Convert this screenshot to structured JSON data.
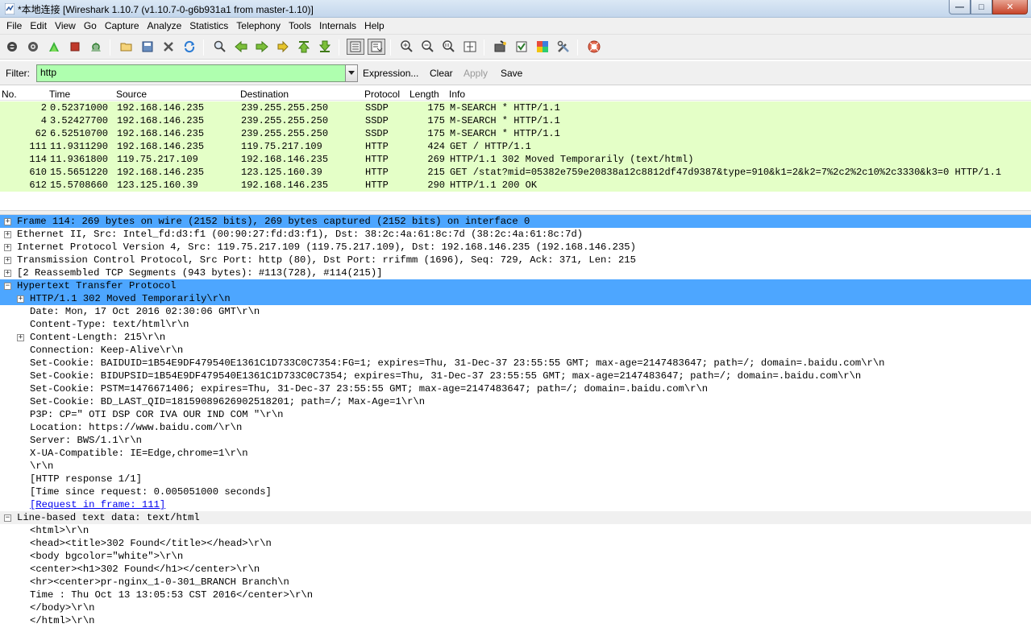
{
  "window": {
    "title": "*本地连接   [Wireshark 1.10.7  (v1.10.7-0-g6b931a1 from master-1.10)]",
    "buttons": {
      "minimize": "—",
      "maximize": "□",
      "close": "✕"
    }
  },
  "menu": [
    "File",
    "Edit",
    "View",
    "Go",
    "Capture",
    "Analyze",
    "Statistics",
    "Telephony",
    "Tools",
    "Internals",
    "Help"
  ],
  "toolbar_icons": [
    "interface-list-icon",
    "capture-options-icon",
    "start-capture-icon",
    "stop-capture-icon",
    "restart-capture-icon",
    "open-file-icon",
    "save-file-icon",
    "close-file-icon",
    "reload-icon",
    "find-packet-icon",
    "go-back-icon",
    "go-forward-icon",
    "go-to-packet-icon",
    "go-first-icon",
    "go-last-icon",
    "colorize-icon",
    "auto-scroll-icon",
    "zoom-in-icon",
    "zoom-out-icon",
    "normal-size-icon",
    "resize-columns-icon",
    "capture-filters-icon",
    "display-filters-icon",
    "coloring-rules-icon",
    "preferences-icon",
    "help-icon"
  ],
  "filter": {
    "label": "Filter:",
    "value": "http",
    "expression": "Expression...",
    "clear": "Clear",
    "apply": "Apply",
    "save": "Save",
    "valid_color": "#afffaf"
  },
  "packet_list": {
    "columns": [
      "No.",
      "Time",
      "Source",
      "Destination",
      "Protocol",
      "Length",
      "Info"
    ],
    "row_color": "#e4ffc7",
    "rows": [
      {
        "no": "2",
        "time": "0.52371000",
        "src": "192.168.146.235",
        "dst": "239.255.255.250",
        "proto": "SSDP",
        "len": "175",
        "info": "M-SEARCH * HTTP/1.1"
      },
      {
        "no": "4",
        "time": "3.52427700",
        "src": "192.168.146.235",
        "dst": "239.255.255.250",
        "proto": "SSDP",
        "len": "175",
        "info": "M-SEARCH * HTTP/1.1"
      },
      {
        "no": "62",
        "time": "6.52510700",
        "src": "192.168.146.235",
        "dst": "239.255.255.250",
        "proto": "SSDP",
        "len": "175",
        "info": "M-SEARCH * HTTP/1.1"
      },
      {
        "no": "111",
        "time": "11.9311290",
        "src": "192.168.146.235",
        "dst": "119.75.217.109",
        "proto": "HTTP",
        "len": "424",
        "info": "GET / HTTP/1.1"
      },
      {
        "no": "114",
        "time": "11.9361800",
        "src": "119.75.217.109",
        "dst": "192.168.146.235",
        "proto": "HTTP",
        "len": "269",
        "info": "HTTP/1.1 302 Moved Temporarily  (text/html)"
      },
      {
        "no": "610",
        "time": "15.5651220",
        "src": "192.168.146.235",
        "dst": "123.125.160.39",
        "proto": "HTTP",
        "len": "215",
        "info": "GET /stat?mid=05382e759e20838a12c8812df47d9387&type=910&k1=2&k2=7%2c2%2c10%2c3330&k3=0 HTTP/1.1"
      },
      {
        "no": "612",
        "time": "15.5708660",
        "src": "123.125.160.39",
        "dst": "192.168.146.235",
        "proto": "HTTP",
        "len": "290",
        "info": "HTTP/1.1 200 OK"
      }
    ]
  },
  "details": {
    "selected_color": "#4da6ff",
    "rows": [
      {
        "text": "Frame 114: 269 bytes on wire (2152 bits), 269 bytes captured (2152 bits) on interface 0",
        "expander": "+",
        "state": "selected"
      },
      {
        "text": "Ethernet II, Src: Intel_fd:d3:f1 (00:90:27:fd:d3:f1), Dst: 38:2c:4a:61:8c:7d (38:2c:4a:61:8c:7d)",
        "expander": "+",
        "state": ""
      },
      {
        "text": "Internet Protocol Version 4, Src: 119.75.217.109 (119.75.217.109), Dst: 192.168.146.235 (192.168.146.235)",
        "expander": "+",
        "state": ""
      },
      {
        "text": "Transmission Control Protocol, Src Port: http (80), Dst Port: rrifmm (1696), Seq: 729, Ack: 371, Len: 215",
        "expander": "+",
        "state": ""
      },
      {
        "text": "[2 Reassembled TCP Segments (943 bytes): #113(728), #114(215)]",
        "expander": "+",
        "state": ""
      },
      {
        "text": "Hypertext Transfer Protocol",
        "expander": "−",
        "state": "selected"
      },
      {
        "text": "HTTP/1.1 302 Moved Temporarily\\r\\n",
        "expander": "+",
        "state": "selected"
      },
      {
        "text": "Date: Mon, 17 Oct 2016 02:30:06 GMT\\r\\n",
        "expander": "",
        "state": ""
      },
      {
        "text": "Content-Type: text/html\\r\\n",
        "expander": "",
        "state": ""
      },
      {
        "text": "Content-Length: 215\\r\\n",
        "expander": "+",
        "state": ""
      },
      {
        "text": "Connection: Keep-Alive\\r\\n",
        "expander": "",
        "state": ""
      },
      {
        "text": "Set-Cookie: BAIDUID=1B54E9DF479540E1361C1D733C0C7354:FG=1; expires=Thu, 31-Dec-37 23:55:55 GMT; max-age=2147483647; path=/; domain=.baidu.com\\r\\n",
        "expander": "",
        "state": ""
      },
      {
        "text": "Set-Cookie: BIDUPSID=1B54E9DF479540E1361C1D733C0C7354; expires=Thu, 31-Dec-37 23:55:55 GMT; max-age=2147483647; path=/; domain=.baidu.com\\r\\n",
        "expander": "",
        "state": ""
      },
      {
        "text": "Set-Cookie: PSTM=1476671406; expires=Thu, 31-Dec-37 23:55:55 GMT; max-age=2147483647; path=/; domain=.baidu.com\\r\\n",
        "expander": "",
        "state": ""
      },
      {
        "text": "Set-Cookie: BD_LAST_QID=18159089626902518201; path=/; Max-Age=1\\r\\n",
        "expander": "",
        "state": ""
      },
      {
        "text": "P3P: CP=\" OTI DSP COR IVA OUR IND COM \"\\r\\n",
        "expander": "",
        "state": ""
      },
      {
        "text": "Location: https://www.baidu.com/\\r\\n",
        "expander": "",
        "state": ""
      },
      {
        "text": "Server: BWS/1.1\\r\\n",
        "expander": "",
        "state": ""
      },
      {
        "text": "X-UA-Compatible: IE=Edge,chrome=1\\r\\n",
        "expander": "",
        "state": ""
      },
      {
        "text": "\\r\\n",
        "expander": "",
        "state": ""
      },
      {
        "text": "[HTTP response 1/1]",
        "expander": "",
        "state": ""
      },
      {
        "text": "[Time since request: 0.005051000 seconds]",
        "expander": "",
        "state": ""
      },
      {
        "text": "[Request in frame: 111]",
        "expander": "",
        "state": "link"
      },
      {
        "text": "Line-based text data: text/html",
        "expander": "−",
        "state": "shade"
      },
      {
        "text": "<html>\\r\\n",
        "expander": "",
        "state": ""
      },
      {
        "text": "<head><title>302 Found</title></head>\\r\\n",
        "expander": "",
        "state": ""
      },
      {
        "text": "<body bgcolor=\"white\">\\r\\n",
        "expander": "",
        "state": ""
      },
      {
        "text": "<center><h1>302 Found</h1></center>\\r\\n",
        "expander": "",
        "state": ""
      },
      {
        "text": "<hr><center>pr-nginx_1-0-301_BRANCH Branch\\n",
        "expander": "",
        "state": ""
      },
      {
        "text": "Time : Thu Oct 13 13:05:53 CST 2016</center>\\r\\n",
        "expander": "",
        "state": ""
      },
      {
        "text": "</body>\\r\\n",
        "expander": "",
        "state": ""
      },
      {
        "text": "</html>\\r\\n",
        "expander": "",
        "state": ""
      }
    ]
  }
}
